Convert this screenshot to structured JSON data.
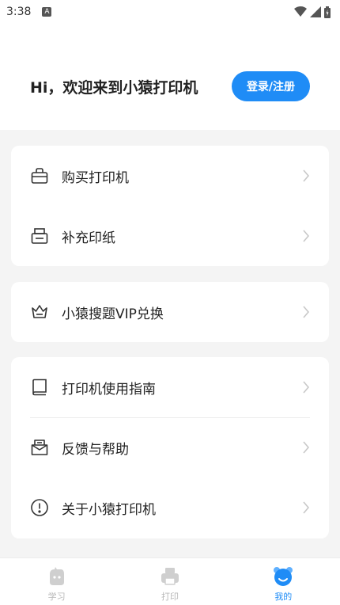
{
  "status_bar": {
    "time": "3:38",
    "badge": "A"
  },
  "header": {
    "greeting": "Hi，欢迎来到小猿打印机",
    "login_label": "登录/注册"
  },
  "menu": {
    "buy_printer": "购买打印机",
    "refill_paper": "补充印纸",
    "vip_redeem": "小猿搜题VIP兑换",
    "guide": "打印机使用指南",
    "feedback": "反馈与帮助",
    "about": "关于小猿打印机"
  },
  "tabs": {
    "study": "学习",
    "print": "打印",
    "mine": "我的"
  },
  "colors": {
    "accent": "#1f8cf6",
    "inactive": "#b8b8b8"
  }
}
